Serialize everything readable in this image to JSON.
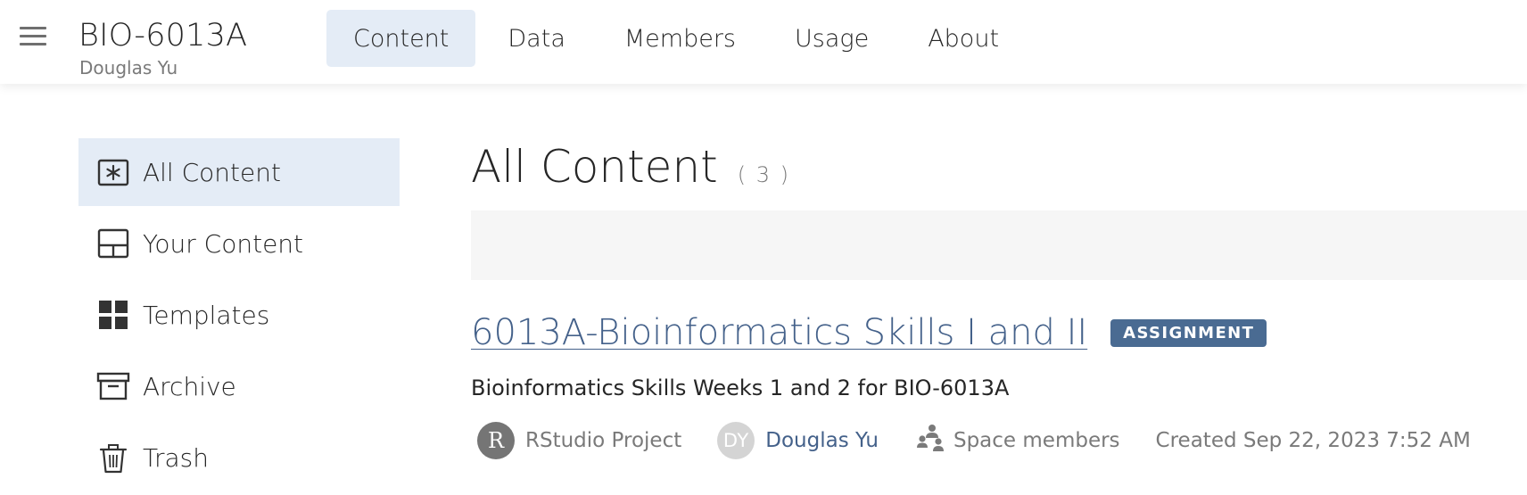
{
  "header": {
    "space_title": "BIO-6013A",
    "space_owner": "Douglas Yu",
    "tabs": [
      {
        "label": "Content",
        "active": true
      },
      {
        "label": "Data",
        "active": false
      },
      {
        "label": "Members",
        "active": false
      },
      {
        "label": "Usage",
        "active": false
      },
      {
        "label": "About",
        "active": false
      }
    ]
  },
  "sidebar": {
    "items": [
      {
        "label": "All Content",
        "icon": "asterisk-box-icon",
        "active": true
      },
      {
        "label": "Your Content",
        "icon": "layout-panel-icon",
        "active": false
      },
      {
        "label": "Templates",
        "icon": "grid-squares-icon",
        "active": false
      },
      {
        "label": "Archive",
        "icon": "archive-box-icon",
        "active": false
      },
      {
        "label": "Trash",
        "icon": "trash-icon",
        "active": false
      }
    ]
  },
  "main": {
    "title": "All Content",
    "count": "( 3 )",
    "items": [
      {
        "title": "6013A-Bioinformatics Skills I and II",
        "badge": "ASSIGNMENT",
        "description": "Bioinformatics Skills Weeks 1 and 2 for BIO-6013A",
        "type_avatar": "R",
        "type_label": "RStudio Project",
        "author_avatar": "DY",
        "author": "Douglas Yu",
        "access": "Space members",
        "created": "Created Sep 22, 2023 7:52 AM"
      }
    ]
  },
  "colors": {
    "accent_bg": "#e4ecf6",
    "link": "#44618a",
    "badge_bg": "#4a6b92"
  }
}
